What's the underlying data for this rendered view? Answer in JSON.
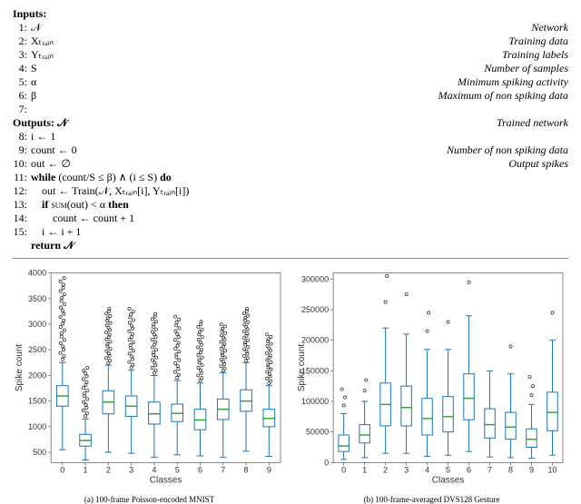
{
  "algo": {
    "inputs_label": "Inputs:",
    "outputs_label": "Outputs:  𝒩",
    "outputs_comment": "Trained network",
    "return_label": "return 𝒩",
    "lines": [
      {
        "n": "1:",
        "code": "𝒩",
        "comment": "Network"
      },
      {
        "n": "2:",
        "code": "Xₜᵣₐᵢₙ",
        "comment": "Training data"
      },
      {
        "n": "3:",
        "code": "Yₜᵣₐᵢₙ",
        "comment": "Training labels"
      },
      {
        "n": "4:",
        "code": "S",
        "comment": "Number of samples"
      },
      {
        "n": "5:",
        "code": "α",
        "comment": "Minimum spiking activity"
      },
      {
        "n": "6:",
        "code": "β",
        "comment": "Maximum of non spiking data"
      },
      {
        "n": "7:",
        "code": "",
        "comment": ""
      }
    ],
    "body": [
      {
        "n": "8:",
        "code": "i ← 1",
        "comment": ""
      },
      {
        "n": "9:",
        "code": "count ← 0",
        "comment": "Number of non spiking data"
      },
      {
        "n": "10:",
        "code": "out ← ∅",
        "comment": "Output spikes"
      },
      {
        "n": "11:",
        "code": "while (count/S ≤ β) ∧ (i ≤ S) do",
        "comment": ""
      },
      {
        "n": "12:",
        "code": "    out ← Train(𝒩, Xₜᵣₐᵢₙ[i], Yₜᵣₐᵢₙ[i])",
        "comment": ""
      },
      {
        "n": "13:",
        "code": "    if SUM(out) < α then",
        "comment": ""
      },
      {
        "n": "14:",
        "code": "        count ← count + 1",
        "comment": ""
      },
      {
        "n": "15:",
        "code": "    i ← i + 1",
        "comment": ""
      }
    ]
  },
  "chart_data": [
    {
      "type": "box",
      "title": "",
      "xlabel": "Classes",
      "ylabel": "Spike count",
      "ylim": [
        300,
        4000
      ],
      "yticks": [
        500,
        1000,
        1500,
        2000,
        2500,
        3000,
        3500,
        4000
      ],
      "categories": [
        "0",
        "1",
        "2",
        "3",
        "4",
        "5",
        "6",
        "7",
        "8",
        "9"
      ],
      "boxes": [
        {
          "min": 550,
          "q1": 1400,
          "median": 1600,
          "q3": 1800,
          "max": 2250,
          "outlier_top": 3900,
          "n_out": 26
        },
        {
          "min": 350,
          "q1": 620,
          "median": 730,
          "q3": 850,
          "max": 1150,
          "outlier_top": 2150,
          "n_out": 18
        },
        {
          "min": 500,
          "q1": 1250,
          "median": 1480,
          "q3": 1700,
          "max": 2200,
          "outlier_top": 3300,
          "n_out": 24
        },
        {
          "min": 480,
          "q1": 1200,
          "median": 1400,
          "q3": 1600,
          "max": 2100,
          "outlier_top": 3300,
          "n_out": 22
        },
        {
          "min": 400,
          "q1": 1050,
          "median": 1250,
          "q3": 1480,
          "max": 2000,
          "outlier_top": 3200,
          "n_out": 24
        },
        {
          "min": 450,
          "q1": 1100,
          "median": 1260,
          "q3": 1440,
          "max": 1900,
          "outlier_top": 3150,
          "n_out": 22
        },
        {
          "min": 430,
          "q1": 940,
          "median": 1130,
          "q3": 1340,
          "max": 1850,
          "outlier_top": 3050,
          "n_out": 24
        },
        {
          "min": 400,
          "q1": 1140,
          "median": 1340,
          "q3": 1540,
          "max": 2050,
          "outlier_top": 3000,
          "n_out": 22
        },
        {
          "min": 520,
          "q1": 1300,
          "median": 1500,
          "q3": 1720,
          "max": 2250,
          "outlier_top": 3300,
          "n_out": 24
        },
        {
          "min": 420,
          "q1": 1000,
          "median": 1160,
          "q3": 1340,
          "max": 1800,
          "outlier_top": 2800,
          "n_out": 22
        }
      ],
      "caption": "(a) 100-frame Poisson-encoded MNIST"
    },
    {
      "type": "box",
      "title": "",
      "xlabel": "Classes",
      "ylabel": "Spike count",
      "ylim": [
        0,
        310000
      ],
      "yticks": [
        0,
        50000,
        100000,
        150000,
        200000,
        250000,
        300000
      ],
      "categories": [
        "0",
        "1",
        "2",
        "3",
        "4",
        "5",
        "6",
        "7",
        "8",
        "9",
        "10"
      ],
      "boxes": [
        {
          "min": 5000,
          "q1": 18000,
          "median": 27000,
          "q3": 45000,
          "max": 80000,
          "outlier_top": 120000,
          "n_out": 3
        },
        {
          "min": 8000,
          "q1": 32000,
          "median": 45000,
          "q3": 62000,
          "max": 100000,
          "outlier_top": 135000,
          "n_out": 2
        },
        {
          "min": 15000,
          "q1": 60000,
          "median": 95000,
          "q3": 130000,
          "max": 220000,
          "outlier_top": 305000,
          "n_out": 2
        },
        {
          "min": 15000,
          "q1": 60000,
          "median": 90000,
          "q3": 125000,
          "max": 210000,
          "outlier_top": 275000,
          "n_out": 1
        },
        {
          "min": 10000,
          "q1": 45000,
          "median": 72000,
          "q3": 105000,
          "max": 185000,
          "outlier_top": 245000,
          "n_out": 2
        },
        {
          "min": 12000,
          "q1": 50000,
          "median": 75000,
          "q3": 108000,
          "max": 185000,
          "outlier_top": 230000,
          "n_out": 1
        },
        {
          "min": 18000,
          "q1": 70000,
          "median": 105000,
          "q3": 145000,
          "max": 240000,
          "outlier_top": 295000,
          "n_out": 1
        },
        {
          "min": 9000,
          "q1": 40000,
          "median": 62000,
          "q3": 88000,
          "max": 150000,
          "outlier_top": 0,
          "n_out": 0
        },
        {
          "min": 8000,
          "q1": 38000,
          "median": 58000,
          "q3": 82000,
          "max": 145000,
          "outlier_top": 190000,
          "n_out": 1
        },
        {
          "min": 7000,
          "q1": 25000,
          "median": 38000,
          "q3": 55000,
          "max": 95000,
          "outlier_top": 140000,
          "n_out": 3
        },
        {
          "min": 12000,
          "q1": 52000,
          "median": 82000,
          "q3": 115000,
          "max": 200000,
          "outlier_top": 245000,
          "n_out": 1
        }
      ],
      "caption": "(b) 100-frame-averaged DVS128 Gesture"
    }
  ]
}
